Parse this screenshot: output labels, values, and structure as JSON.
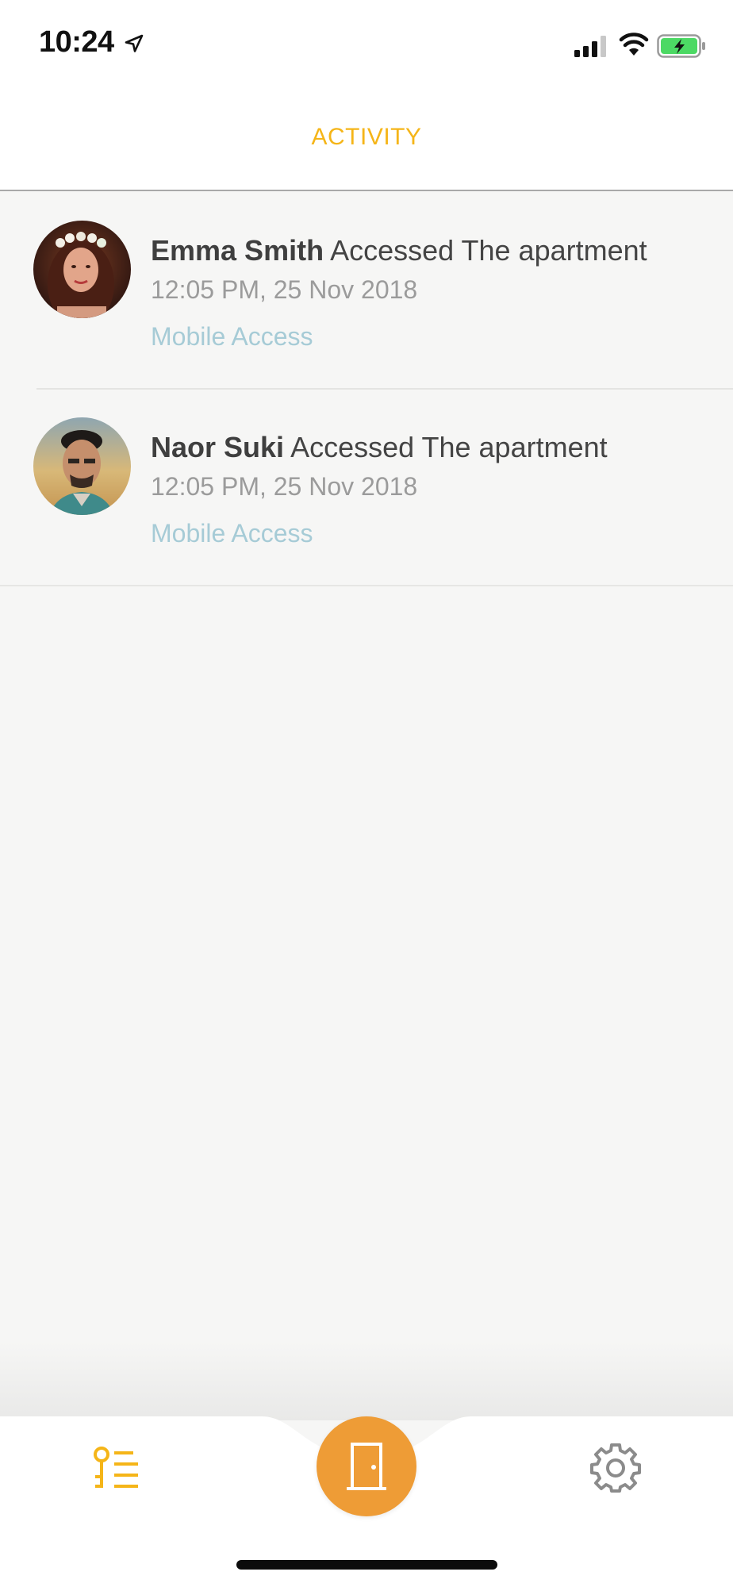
{
  "status_bar": {
    "time": "10:24",
    "icons": [
      "location-arrow-icon",
      "cellular-signal-icon",
      "wifi-icon",
      "battery-charging-icon"
    ]
  },
  "header": {
    "title": "ACTIVITY",
    "title_color": "#f5b518"
  },
  "activity": [
    {
      "name": "Emma Smith",
      "action": "Accessed The apartment",
      "time": "12:05 PM, 25 Nov 2018",
      "method": "Mobile Access"
    },
    {
      "name": "Naor Suki",
      "action": "Accessed The apartment",
      "time": "12:05 PM, 25 Nov 2018",
      "method": "Mobile Access"
    }
  ],
  "tab_bar": {
    "tabs": [
      "activity-tab",
      "door-tab",
      "settings-tab"
    ],
    "icons": [
      "activity-list-icon",
      "door-icon",
      "gear-icon"
    ],
    "active": "activity-tab",
    "accent_color": "#f5b518",
    "door_button_color": "#ee9c36"
  },
  "colors": {
    "background": "#f6f6f5",
    "method_text": "#a6cbd6",
    "secondary_text": "#9b9b9b"
  }
}
